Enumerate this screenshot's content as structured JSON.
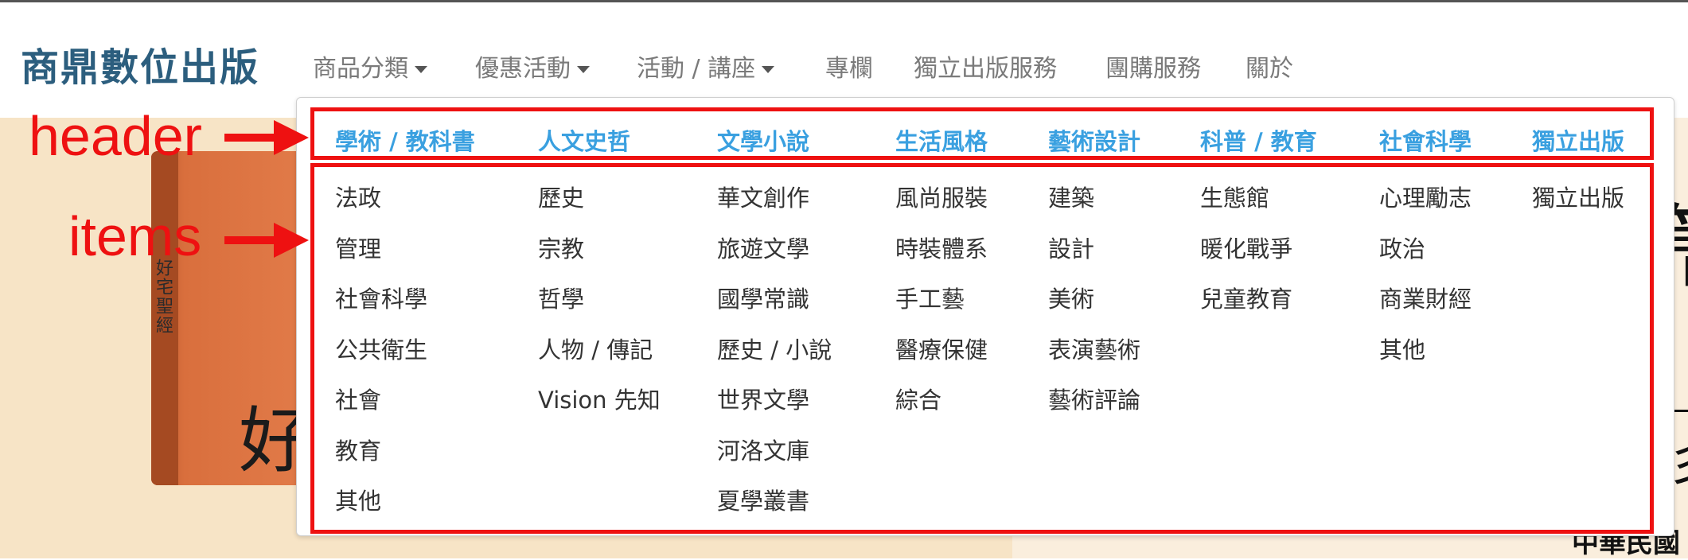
{
  "brand": "商鼎數位出版",
  "nav": [
    {
      "label": "商品分類",
      "dropdown": true
    },
    {
      "label": "優惠活動",
      "dropdown": true
    },
    {
      "label": "活動 / 講座",
      "dropdown": true
    },
    {
      "label": "專欄",
      "dropdown": false
    },
    {
      "label": "獨立出版服務",
      "dropdown": false
    },
    {
      "label": "團購服務",
      "dropdown": false
    },
    {
      "label": "關於",
      "dropdown": false
    }
  ],
  "menu": {
    "columns": [
      {
        "header": "學術 / 教科書",
        "items": [
          "法政",
          "管理",
          "社會科學",
          "公共衛生",
          "社會",
          "教育",
          "其他"
        ]
      },
      {
        "header": "人文史哲",
        "items": [
          "歷史",
          "宗教",
          "哲學",
          "人物 / 傳記",
          "Vision 先知"
        ]
      },
      {
        "header": "文學小說",
        "items": [
          "華文創作",
          "旅遊文學",
          "國學常識",
          "歷史 / 小說",
          "世界文學",
          "河洛文庫",
          "夏學叢書"
        ]
      },
      {
        "header": "生活風格",
        "items": [
          "風尚服裝",
          "時裝體系",
          "手工藝",
          "醫療保健",
          "綜合"
        ]
      },
      {
        "header": "藝術設計",
        "items": [
          "建築",
          "設計",
          "美術",
          "表演藝術",
          "藝術評論"
        ]
      },
      {
        "header": "科普 / 教育",
        "items": [
          "生態館",
          "暖化戰爭",
          "兒童教育"
        ]
      },
      {
        "header": "社會科學",
        "items": [
          "心理勵志",
          "政治",
          "商業財經",
          "其他"
        ]
      },
      {
        "header": "獨立出版",
        "items": [
          "獨立出版"
        ]
      }
    ]
  },
  "annotations": {
    "header": "header",
    "items": "items"
  },
  "background": {
    "book_spine_text": "好宅聖經",
    "book_cover_char": "好",
    "right_char_top": "簡",
    "right_char_mid": "彡",
    "right_bottom_text": "中華民國"
  },
  "colors": {
    "annotation": "#ee1111",
    "header_text": "#3aa0e0",
    "brand": "#2c5e7e"
  }
}
